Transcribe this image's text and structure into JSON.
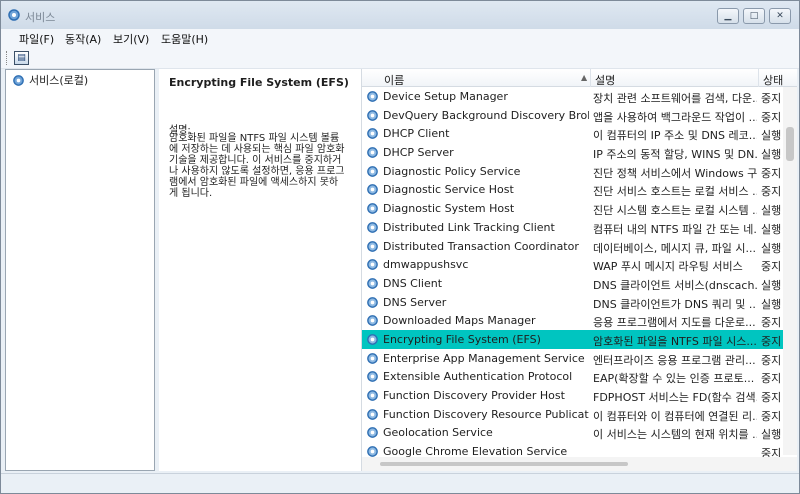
{
  "window": {
    "title": "서비스"
  },
  "menu": [
    "파일(F)",
    "동작(A)",
    "보기(V)",
    "도움말(H)"
  ],
  "tree": {
    "root_label": "서비스(로컬)"
  },
  "detail": {
    "title": "Encrypting File System (EFS)",
    "desc_label": "설명:",
    "desc_text": "암호화된 파일을 NTFS 파일 시스템 볼륨에 저장하는 데 사용되는 핵심 파일 암호화 기술을 제공합니다. 이 서비스를 중지하거나 사용하지 않도록 설정하면, 응용 프로그램에서 암호화된 파일에 액세스하지 못하게 됩니다."
  },
  "list": {
    "columns": {
      "name": "이름",
      "desc": "설명",
      "status": "상태"
    },
    "rows": [
      {
        "name": "Device Setup Manager",
        "desc": "장치 관련 소프트웨어를 검색, 다운...",
        "status": "중지"
      },
      {
        "name": "DevQuery Background Discovery Broker",
        "desc": "앱을 사용하여 백그라운드 작업이 ...",
        "status": "중지"
      },
      {
        "name": "DHCP Client",
        "desc": "이 컴퓨터의 IP 주소 및 DNS 레코...",
        "status": "실행"
      },
      {
        "name": "DHCP Server",
        "desc": "IP 주소의 동적 할당, WINS 및 DN...",
        "status": "실행"
      },
      {
        "name": "Diagnostic Policy Service",
        "desc": "진단 정책 서비스에서 Windows 구...",
        "status": "중지"
      },
      {
        "name": "Diagnostic Service Host",
        "desc": "진단 서비스 호스트는 로컬 서비스 ...",
        "status": "중지"
      },
      {
        "name": "Diagnostic System Host",
        "desc": "진단 시스템 호스트는 로컬 시스템 ...",
        "status": "실행"
      },
      {
        "name": "Distributed Link Tracking Client",
        "desc": "컴퓨터 내의 NTFS 파일 간 또는 네...",
        "status": "실행"
      },
      {
        "name": "Distributed Transaction Coordinator",
        "desc": "데이터베이스, 메시지 큐, 파일 시...",
        "status": "실행"
      },
      {
        "name": "dmwappushsvc",
        "desc": "WAP 푸시 메시지 라우팅 서비스",
        "status": "중지"
      },
      {
        "name": "DNS Client",
        "desc": "DNS 클라이언트 서비스(dnscach...",
        "status": "실행"
      },
      {
        "name": "DNS Server",
        "desc": "DNS 클라이언트가 DNS 쿼리 및 ...",
        "status": "실행"
      },
      {
        "name": "Downloaded Maps Manager",
        "desc": "응용 프로그램에서 지도를 다운로...",
        "status": "중지"
      },
      {
        "name": "Encrypting File System (EFS)",
        "desc": "암호화된 파일을 NTFS 파일 시스...",
        "status": "중지"
      },
      {
        "name": "Enterprise App Management Service",
        "desc": "엔터프라이즈 응용 프로그램 관리...",
        "status": "중지"
      },
      {
        "name": "Extensible Authentication Protocol",
        "desc": "EAP(확장할 수 있는 인증 프로토...",
        "status": "중지"
      },
      {
        "name": "Function Discovery Provider Host",
        "desc": "FDPHOST 서비스는 FD(함수 검색...",
        "status": "중지"
      },
      {
        "name": "Function Discovery Resource Publication",
        "desc": "이 컴퓨터와 이 컴퓨터에 연결된 리...",
        "status": "중지"
      },
      {
        "name": "Geolocation Service",
        "desc": "이 서비스는 시스템의 현재 위치를 ...",
        "status": "실행"
      },
      {
        "name": "Google Chrome Elevation Service",
        "desc": "",
        "status": "중지"
      }
    ]
  },
  "colors": {
    "selection": "#00c5c0",
    "gear_blue": "#2f6fb3"
  }
}
